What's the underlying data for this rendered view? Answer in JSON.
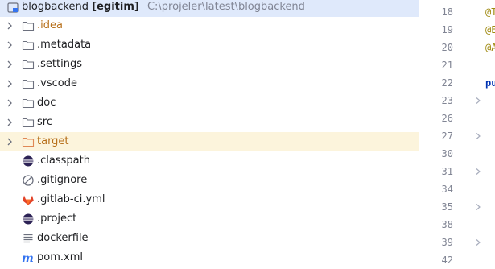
{
  "project_tree": {
    "root": {
      "name": "blogbackend",
      "module": "[egitim]",
      "path": "C:\\projeler\\latest\\blogbackend"
    },
    "items": [
      {
        "label": ".idea",
        "type": "folder"
      },
      {
        "label": ".metadata",
        "type": "folder"
      },
      {
        "label": ".settings",
        "type": "folder"
      },
      {
        "label": ".vscode",
        "type": "folder"
      },
      {
        "label": "doc",
        "type": "folder"
      },
      {
        "label": "src",
        "type": "folder"
      },
      {
        "label": "target",
        "type": "folder-excluded"
      },
      {
        "label": ".classpath",
        "type": "eclipse-file"
      },
      {
        "label": ".gitignore",
        "type": "ignore-file"
      },
      {
        "label": ".gitlab-ci.yml",
        "type": "gitlab-file"
      },
      {
        "label": ".project",
        "type": "eclipse-file"
      },
      {
        "label": "dockerfile",
        "type": "text-file"
      },
      {
        "label": "pom.xml",
        "type": "maven-file"
      }
    ]
  },
  "editor": {
    "line_numbers": [
      "18",
      "19",
      "20",
      "21",
      "22",
      "23",
      "26",
      "27",
      "30",
      "31",
      "34",
      "35",
      "38",
      "39",
      "42"
    ],
    "fold_lines": [
      "23",
      "27",
      "31",
      "35",
      "39"
    ],
    "code_fragments": [
      {
        "line": "18",
        "text": "@T"
      },
      {
        "line": "19",
        "text": "@E"
      },
      {
        "line": "20",
        "text": "@A"
      },
      {
        "line": "22",
        "text": "pu"
      }
    ]
  },
  "colors": {
    "selected_row": "#dfe9fb",
    "highlighted_row": "#fcf4dc",
    "excluded_folder_text": "#b7701b",
    "path_text": "#818594"
  }
}
